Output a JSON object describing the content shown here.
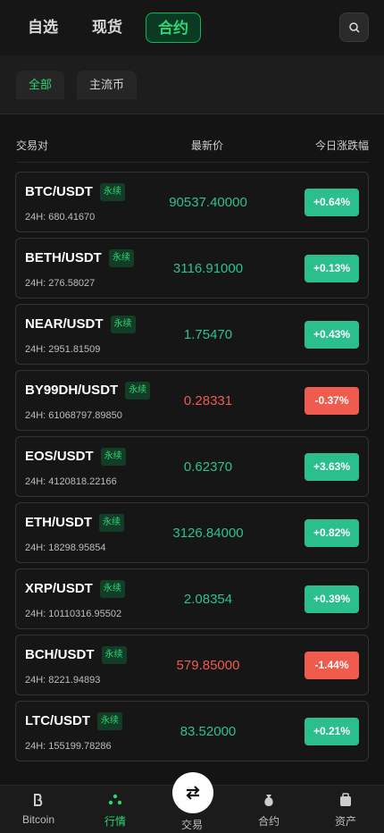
{
  "top_tabs": [
    "自选",
    "现货",
    "合约"
  ],
  "filters": [
    "全部",
    "主流币"
  ],
  "columns": {
    "pair": "交易对",
    "price": "最新价",
    "change": "今日涨跌幅"
  },
  "tag_label": "永续",
  "rows": [
    {
      "symbol": "BTC/USDT",
      "vol": "24H: 680.41670",
      "price": "90537.40000",
      "change": "+0.64%",
      "dir": "up"
    },
    {
      "symbol": "BETH/USDT",
      "vol": "24H: 276.58027",
      "price": "3116.91000",
      "change": "+0.13%",
      "dir": "up"
    },
    {
      "symbol": "NEAR/USDT",
      "vol": "24H: 2951.81509",
      "price": "1.75470",
      "change": "+0.43%",
      "dir": "up"
    },
    {
      "symbol": "BY99DH/USDT",
      "vol": "24H: 61068797.89850",
      "price": "0.28331",
      "change": "-0.37%",
      "dir": "down"
    },
    {
      "symbol": "EOS/USDT",
      "vol": "24H: 4120818.22166",
      "price": "0.62370",
      "change": "+3.63%",
      "dir": "up"
    },
    {
      "symbol": "ETH/USDT",
      "vol": "24H: 18298.95854",
      "price": "3126.84000",
      "change": "+0.82%",
      "dir": "up"
    },
    {
      "symbol": "XRP/USDT",
      "vol": "24H: 10110316.95502",
      "price": "2.08354",
      "change": "+0.39%",
      "dir": "up"
    },
    {
      "symbol": "BCH/USDT",
      "vol": "24H: 8221.94893",
      "price": "579.85000",
      "change": "-1.44%",
      "dir": "down"
    },
    {
      "symbol": "LTC/USDT",
      "vol": "24H: 155199.78286",
      "price": "83.52000",
      "change": "+0.21%",
      "dir": "up"
    }
  ],
  "nav": {
    "bitcoin": "Bitcoin",
    "market": "行情",
    "trade": "交易",
    "contract": "合约",
    "assets": "资产"
  },
  "colors": {
    "up": "#2bbf8e",
    "down": "#ef5b4d",
    "accent": "#2ed573"
  }
}
